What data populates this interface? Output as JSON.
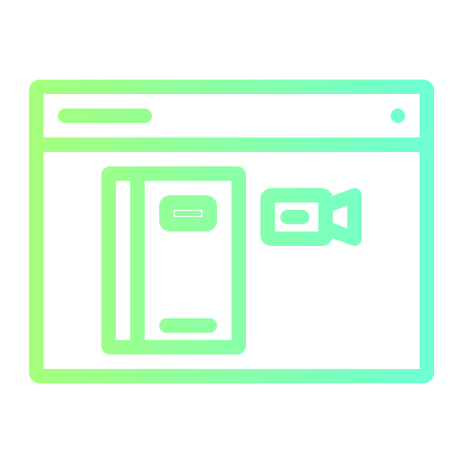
{
  "icon": {
    "name": "browser-window-with-book-and-video-camera",
    "gradient_start": "#A6FF7A",
    "gradient_end": "#6EFFD4"
  }
}
